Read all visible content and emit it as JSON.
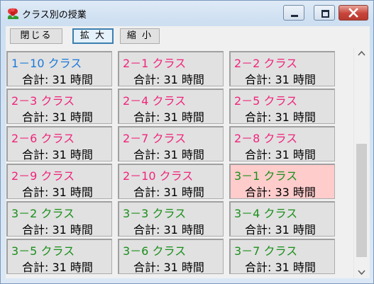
{
  "window": {
    "title": "クラス別の授業",
    "app_icon": "rose-icon"
  },
  "toolbar": {
    "close_label": "閉じる",
    "zoom_in_label": "拡 大",
    "zoom_out_label": "縮 小"
  },
  "colors": {
    "grade1": "#1a79d9",
    "grade2": "#f0257b",
    "grade3": "#1a8f1a",
    "highlight_bg": "#ffcccc",
    "close_button": "#c7443a"
  },
  "classes": [
    {
      "name": "1－10 クラス",
      "total": "合計: 31 時間",
      "color": "blue"
    },
    {
      "name": "2－1 クラス",
      "total": "合計: 31 時間",
      "color": "pink"
    },
    {
      "name": "2－2 クラス",
      "total": "合計: 31 時間",
      "color": "pink"
    },
    {
      "name": "2－3 クラス",
      "total": "合計: 31 時間",
      "color": "pink"
    },
    {
      "name": "2－4 クラス",
      "total": "合計: 31 時間",
      "color": "pink"
    },
    {
      "name": "2－5 クラス",
      "total": "合計: 31 時間",
      "color": "pink"
    },
    {
      "name": "2－6 クラス",
      "total": "合計: 31 時間",
      "color": "pink"
    },
    {
      "name": "2－7 クラス",
      "total": "合計: 31 時間",
      "color": "pink"
    },
    {
      "name": "2－8 クラス",
      "total": "合計: 31 時間",
      "color": "pink"
    },
    {
      "name": "2－9 クラス",
      "total": "合計: 31 時間",
      "color": "pink"
    },
    {
      "name": "2－10 クラス",
      "total": "合計: 31 時間",
      "color": "pink"
    },
    {
      "name": "3－1 クラス",
      "total": "合計: 33 時間",
      "color": "green",
      "highlighted": true
    },
    {
      "name": "3－2 クラス",
      "total": "合計: 31 時間",
      "color": "green"
    },
    {
      "name": "3－3 クラス",
      "total": "合計: 31 時間",
      "color": "green"
    },
    {
      "name": "3－4 クラス",
      "total": "合計: 31 時間",
      "color": "green"
    },
    {
      "name": "3－5 クラス",
      "total": "合計: 31 時間",
      "color": "green"
    },
    {
      "name": "3－6 クラス",
      "total": "合計: 31 時間",
      "color": "green"
    },
    {
      "name": "3－7 クラス",
      "total": "合計: 31 時間",
      "color": "green"
    }
  ]
}
